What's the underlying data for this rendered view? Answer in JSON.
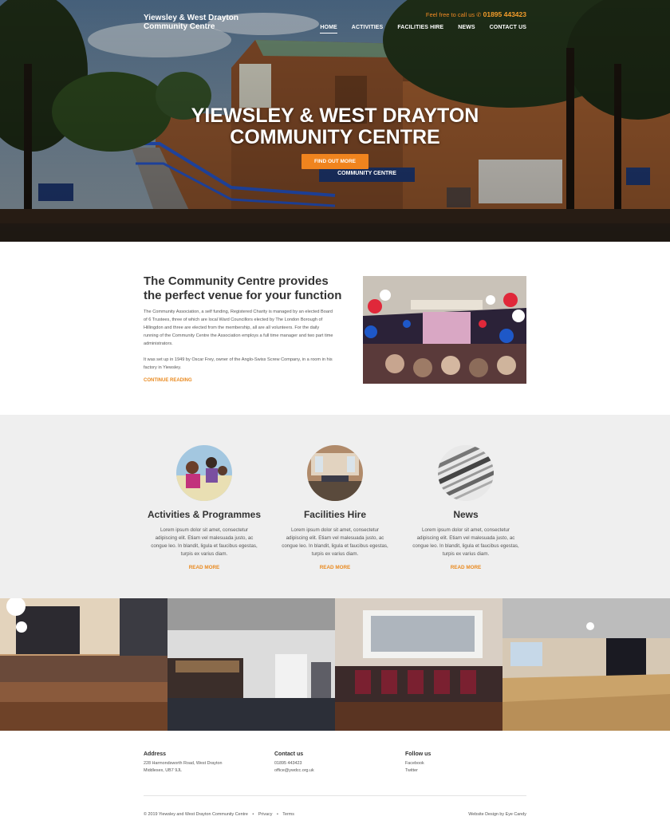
{
  "header": {
    "brand": "Yiewsley & West Drayton Community Centre",
    "phone_prefix": "Feel free to call us",
    "phone_number": "01895 443423",
    "nav": [
      "HOME",
      "ACTIVITIES",
      "FACILITIES HIRE",
      "NEWS",
      "CONTACT US"
    ],
    "active_nav": "HOME"
  },
  "hero": {
    "title_line1": "YIEWSLEY & WEST DRAYTON",
    "title_line2": "COMMUNITY CENTRE",
    "cta_label": "FIND OUT MORE",
    "sign_text": "COMMUNITY CENTRE"
  },
  "intro": {
    "heading": "The Community Centre provides the perfect venue for your function",
    "para1": "The Community Association, a self funding, Registered Charity is managed by an elected Board of 6 Trustees, three of which are local Ward Councillors elected by The London Borough of Hillingdon and three are elected from the membership, all are all volunteers. For the daily running of the Community Centre the Association employs a full time manager and two part time administrators.",
    "para2": "It was set up in 1949 by Oscar Frey, owner of the Anglo-Swiss Screw Company, in a room in his factory in Yiewsley.",
    "link": "CONTINUE READING"
  },
  "services": [
    {
      "title": "Activities & Programmes",
      "text": "Lorem ipsum dolor sit amet, consectetur adipiscing elit. Etiam vel malesuada justo, ac congue leo. In blandit, ligula et faucibus egestas, turpis ex varius diam.",
      "link": "READ MORE"
    },
    {
      "title": "Facilities Hire",
      "text": "Lorem ipsum dolor sit amet, consectetur adipiscing elit. Etiam vel malesuada justo, ac congue leo. In blandit, ligula et faucibus egestas, turpis ex varius diam.",
      "link": "READ MORE"
    },
    {
      "title": "News",
      "text": "Lorem ipsum dolor sit amet, consectetur adipiscing elit. Etiam vel malesuada justo, ac congue leo. In blandit, ligula et faucibus egestas, turpis ex varius diam.",
      "link": "READ MORE"
    }
  ],
  "footer": {
    "address_h": "Address",
    "address_1": "228 Harmondsworth Road, West Drayton",
    "address_2": "Middlesex, UB7 9JL",
    "contact_h": "Contact us",
    "contact_phone": "01895 443423",
    "contact_email": "office@ywdcc.org.uk",
    "follow_h": "Follow us",
    "follow_1": "Facebook",
    "follow_2": "Twitter",
    "copyright": "© 2019 Yiewsley and West Drayton Community Centre",
    "privacy": "Privacy",
    "terms": "Terms",
    "sep": "•",
    "credit": "Website Design by Eye Candy"
  },
  "colors": {
    "accent": "#f0841e",
    "light_bg": "#efefef",
    "text": "#444444"
  }
}
